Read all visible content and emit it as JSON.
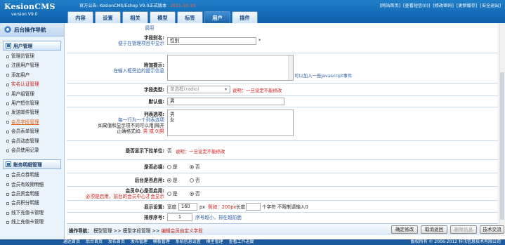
{
  "header": {
    "brand": "KesionCMS",
    "version": "version V9.0",
    "notice_label": "官方公告:",
    "notice_link": "KesionCMS/Eshop V9.0正式版本",
    "notice_date": "2011-10-10",
    "top_links": [
      "[网站首页]",
      "[查看短信(0)]",
      "[修改密码]",
      "[更新缓存]",
      "[安全退出]"
    ],
    "tabs": [
      "内容",
      "设置",
      "相关",
      "模型",
      "标签",
      "用户",
      "插件"
    ],
    "active_tab": 5
  },
  "sidebar": {
    "title": "后台操作导航",
    "groups": [
      {
        "title": "用户管理",
        "items": [
          {
            "label": "管理员管理"
          },
          {
            "label": "注册用户管理"
          },
          {
            "label": "添加用户"
          },
          {
            "label": "实名认证管理",
            "style": "red"
          },
          {
            "label": "用户组管理"
          },
          {
            "label": "用户短信管理"
          },
          {
            "label": "发送邮件管理"
          },
          {
            "label": "会员字段管理",
            "style": "active"
          },
          {
            "label": "会员表单管理"
          },
          {
            "label": "会员动态管理"
          },
          {
            "label": "会员使用记录"
          }
        ]
      },
      {
        "title": "账务明细管理",
        "items": [
          {
            "label": "会员点券明细"
          },
          {
            "label": "会员有效期明细"
          },
          {
            "label": "会员资金明细"
          },
          {
            "label": "会员积分明细"
          },
          {
            "label": "线下充值卡管理"
          },
          {
            "label": "线上充值卡管理"
          }
        ]
      }
    ]
  },
  "form": {
    "top_note": "调用",
    "alias_label": "字段别名:",
    "alias_hint": "便于在管理项目中显示",
    "alias_value": "性别",
    "alias_required": "*",
    "extra_label": "附加提示:",
    "extra_hint": "在输入框旁边的提示信息",
    "extra_note": "可以加入一些javascript事件",
    "type_label": "字段类型:",
    "type_value": "单选框(radio)",
    "type_note": "说明：一旦设定不能修改",
    "default_label": "默认值:",
    "default_value": "男",
    "options_label": "列表选项:",
    "options_hint_1": "每一行为一个列表选项",
    "options_hint_2": "如果值和显示项不同可以用|隔开",
    "options_hint_3": "正确格式如:",
    "options_hint_example": "男 或 0|男",
    "options_value": "男\n女",
    "show_unit_label": "是否显示下拉单位:",
    "show_unit_value": "否",
    "show_unit_note": "说明：一旦设定不能修改",
    "required_label": "是否必填:",
    "enabled_label": "后台是否启用:",
    "member_label": "会员中心是否启用:",
    "member_hint": "必须是启用，前台的会员中心才会显示",
    "radio_yes": "是",
    "radio_no": "否",
    "required_selected": "no",
    "enabled_selected": "yes",
    "member_selected": "no",
    "display_label": "显示设置:",
    "width_label": "宽度",
    "width_value": "160",
    "width_unit": "px",
    "width_example": "例如：200px",
    "length_label": "长度",
    "length_note": "个字符 不限制请输入0",
    "order_label": "排序序号:",
    "order_value": "1",
    "order_note": "序号越小，排在越前面"
  },
  "action_bar": {
    "crumb_label": "操作导航：",
    "crumb_path": "模型管理 >> 模型字段管理 >>",
    "crumb_current": "编辑会员自定义字段",
    "buttons": [
      "确定修改",
      "取消返回",
      "删除信息",
      "技术交流"
    ]
  },
  "footer": {
    "links": [
      "通达首页",
      "后台首页",
      "发布首页",
      "发布管理",
      "模板管理",
      "系统信息设置",
      "模型管理",
      "查看工作进度"
    ],
    "copyright": "版权所有 © 2006-2012 科汛信息技术有限公司"
  }
}
